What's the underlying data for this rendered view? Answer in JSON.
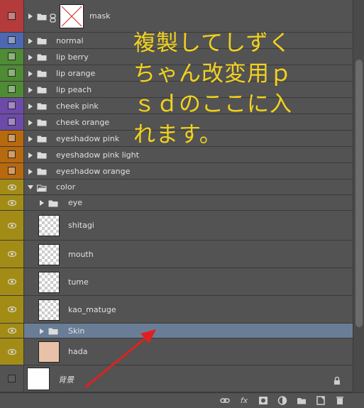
{
  "colors": {
    "red": "#b33b3b",
    "blue": "#4d68b0",
    "green": "#4f8a35",
    "purple": "#6d4aa8",
    "orange": "#b8690e",
    "olive": "#a38c16",
    "selected": "#6a7d96",
    "annotation": "#f2d21c",
    "arrow": "#e02020"
  },
  "layers": [
    {
      "label": "mask",
      "tag": "red",
      "kind": "group-mask"
    },
    {
      "label": "normal",
      "tag": "blue",
      "kind": "group"
    },
    {
      "label": "lip berry",
      "tag": "green",
      "kind": "group"
    },
    {
      "label": "lip orange",
      "tag": "green",
      "kind": "group"
    },
    {
      "label": "lip peach",
      "tag": "green",
      "kind": "group"
    },
    {
      "label": "cheek pink",
      "tag": "purple",
      "kind": "group"
    },
    {
      "label": "cheek orange",
      "tag": "purple",
      "kind": "group"
    },
    {
      "label": "eyeshadow pink",
      "tag": "orange",
      "kind": "group"
    },
    {
      "label": "eyeshadow pink light",
      "tag": "orange",
      "kind": "group"
    },
    {
      "label": "eyeshadow orange",
      "tag": "orange",
      "kind": "group"
    },
    {
      "label": "color",
      "tag": "olive",
      "kind": "group-open",
      "visible": true
    },
    {
      "label": "eye",
      "tag": "olive",
      "kind": "subgroup",
      "visible": true
    },
    {
      "label": "shitagi",
      "tag": "olive",
      "kind": "layer",
      "visible": true
    },
    {
      "label": "mouth",
      "tag": "olive",
      "kind": "layer",
      "visible": true
    },
    {
      "label": "tume",
      "tag": "olive",
      "kind": "layer",
      "visible": true
    },
    {
      "label": "kao_matuge",
      "tag": "olive",
      "kind": "layer",
      "visible": true
    },
    {
      "label": "Skin",
      "tag": "olive",
      "kind": "subgroup",
      "visible": true,
      "selected": true
    },
    {
      "label": "hada",
      "tag": "olive",
      "kind": "layer",
      "visible": true
    },
    {
      "label": "背景",
      "tag": "none",
      "kind": "background"
    }
  ],
  "annotation": {
    "lines": [
      "複製してしずく",
      "ちゃん改変用ｐ",
      "ｓｄのここに入",
      "れます。"
    ]
  },
  "bottom_icons": [
    "link-layers-icon",
    "fx-icon",
    "add-mask-icon",
    "adjustment-layer-icon",
    "new-group-icon",
    "new-layer-icon",
    "delete-layer-icon"
  ],
  "bottom_icon_glyphs": {
    "fx": "fx"
  }
}
